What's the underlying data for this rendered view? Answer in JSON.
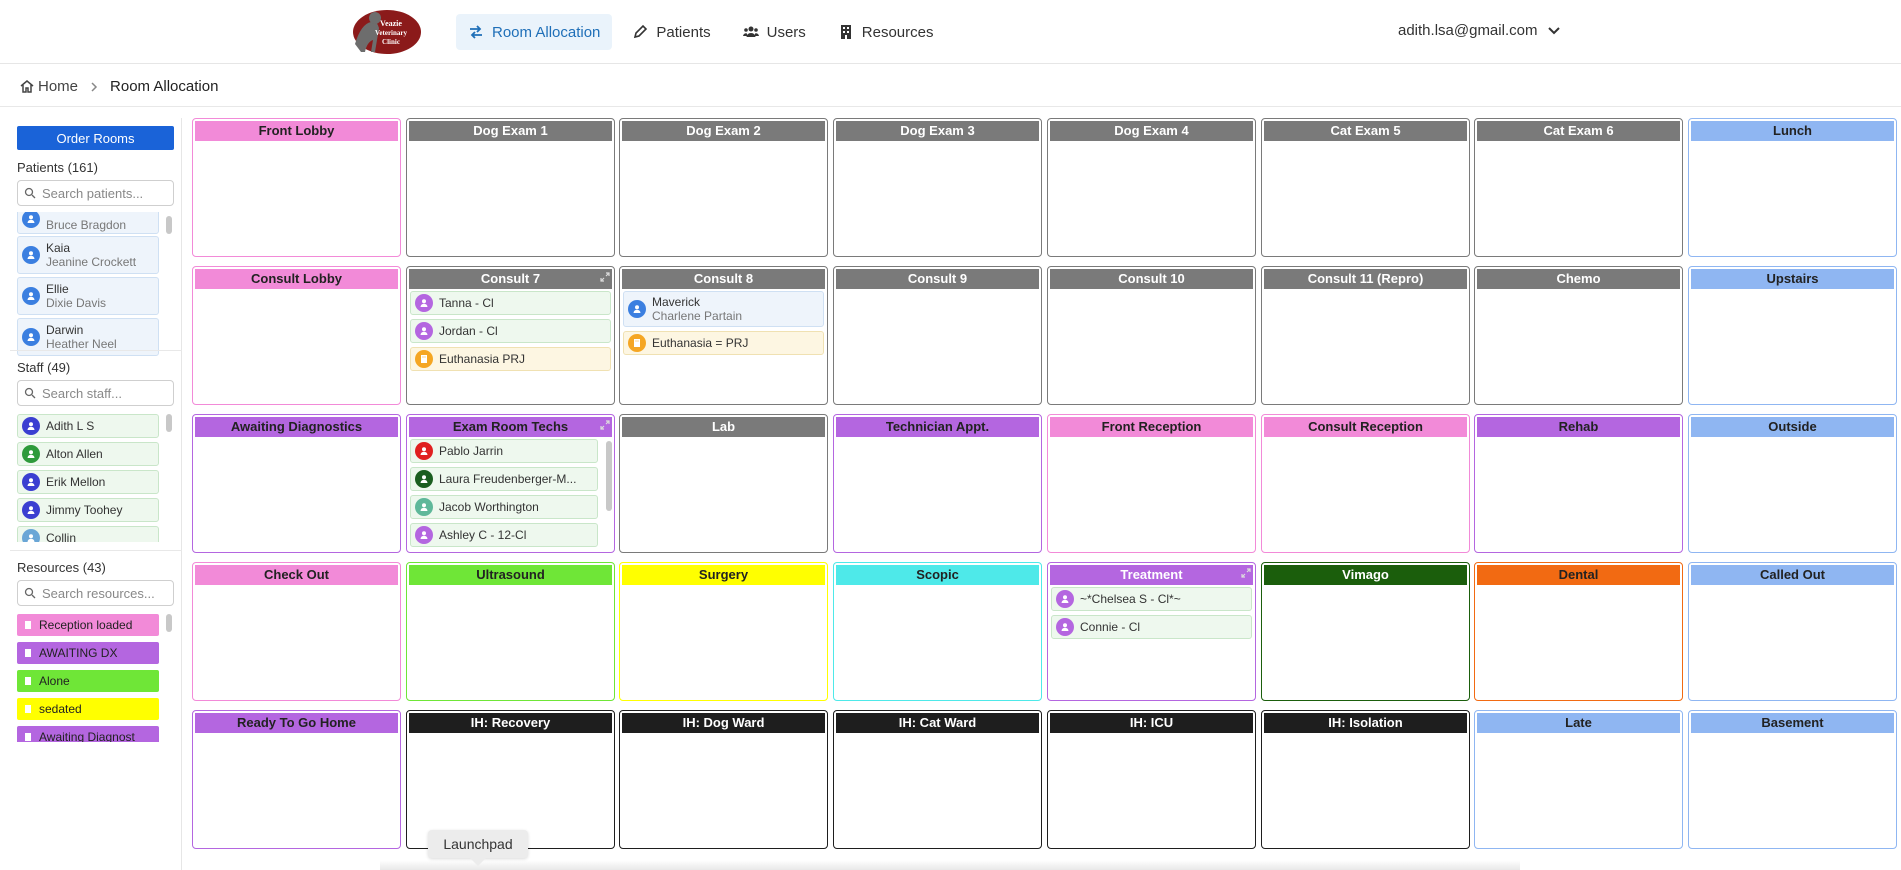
{
  "clinic_logo": "Veazie Veterinary Clinic",
  "nav": {
    "items": [
      {
        "label": "Room Allocation",
        "icon": "swap-icon",
        "active": true
      },
      {
        "label": "Patients",
        "icon": "pencil-icon",
        "active": false
      },
      {
        "label": "Users",
        "icon": "users-icon",
        "active": false
      },
      {
        "label": "Resources",
        "icon": "building-icon",
        "active": false
      }
    ],
    "user_email": "adith.lsa@gmail.com"
  },
  "breadcrumb": {
    "home": "Home",
    "current": "Room Allocation"
  },
  "sidebar": {
    "order_button": "Order Rooms",
    "patients": {
      "title": "Patients (161)",
      "placeholder": "Search patients...",
      "items": [
        {
          "name": "",
          "owner": "Bruce Bragdon"
        },
        {
          "name": "Kaia",
          "owner": "Jeanine Crockett"
        },
        {
          "name": "Ellie",
          "owner": "Dixie Davis"
        },
        {
          "name": "Darwin",
          "owner": "Heather Neel"
        }
      ]
    },
    "staff": {
      "title": "Staff (49)",
      "placeholder": "Search staff...",
      "items": [
        {
          "name": "Adith L S",
          "color": "#3b3fd1"
        },
        {
          "name": "Alton Allen",
          "color": "#2e9a3b"
        },
        {
          "name": "Erik Mellon",
          "color": "#3b3fd1"
        },
        {
          "name": "Jimmy Toohey",
          "color": "#3b3fd1"
        },
        {
          "name": "Collin",
          "color": "#6aa6d6"
        }
      ]
    },
    "resources": {
      "title": "Resources (43)",
      "placeholder": "Search resources...",
      "items": [
        {
          "label": "Reception loaded",
          "color": "#f28ad8"
        },
        {
          "label": "AWAITING DX",
          "color": "#b466e0"
        },
        {
          "label": "Alone",
          "color": "#6fe637"
        },
        {
          "label": "sedated",
          "color": "#ffff00"
        },
        {
          "label": "Awaiting Diagnost",
          "color": "#b466e0"
        }
      ]
    }
  },
  "rooms": [
    {
      "name": "Front Lobby",
      "color": "#f28ad8",
      "dark": true,
      "cards": []
    },
    {
      "name": "Dog Exam 1",
      "color": "#7a7a7a",
      "dark": false,
      "cards": []
    },
    {
      "name": "Dog Exam 2",
      "color": "#7a7a7a",
      "dark": false,
      "cards": []
    },
    {
      "name": "Dog Exam 3",
      "color": "#7a7a7a",
      "dark": false,
      "cards": []
    },
    {
      "name": "Dog Exam 4",
      "color": "#7a7a7a",
      "dark": false,
      "cards": []
    },
    {
      "name": "Cat Exam 5",
      "color": "#7a7a7a",
      "dark": false,
      "cards": []
    },
    {
      "name": "Cat Exam 6",
      "color": "#7a7a7a",
      "dark": false,
      "cards": []
    },
    {
      "name": "Lunch",
      "color": "#8fb6f2",
      "dark": true,
      "cards": []
    },
    {
      "name": "Consult Lobby",
      "color": "#f28ad8",
      "dark": true,
      "cards": []
    },
    {
      "name": "Consult 7",
      "color": "#7a7a7a",
      "dark": false,
      "expand": true,
      "cards": [
        {
          "type": "staff",
          "label": "Tanna - Cl",
          "color": "#b466e0"
        },
        {
          "type": "staff",
          "label": "Jordan - Cl",
          "color": "#b466e0"
        },
        {
          "type": "res",
          "label": "Euthanasia PRJ",
          "color": "#f5a623"
        }
      ]
    },
    {
      "name": "Consult 8",
      "color": "#7a7a7a",
      "dark": false,
      "cards": [
        {
          "type": "patient",
          "label": "Maverick",
          "sub": "Charlene Partain",
          "color": "#3b7fe0"
        },
        {
          "type": "res",
          "label": "Euthanasia = PRJ",
          "color": "#f5a623"
        }
      ]
    },
    {
      "name": "Consult 9",
      "color": "#7a7a7a",
      "dark": false,
      "cards": []
    },
    {
      "name": "Consult 10",
      "color": "#7a7a7a",
      "dark": false,
      "cards": []
    },
    {
      "name": "Consult 11 (Repro)",
      "color": "#7a7a7a",
      "dark": false,
      "cards": []
    },
    {
      "name": "Chemo",
      "color": "#7a7a7a",
      "dark": false,
      "cards": []
    },
    {
      "name": "Upstairs",
      "color": "#8fb6f2",
      "dark": true,
      "cards": []
    },
    {
      "name": "Awaiting Diagnostics",
      "color": "#b466e0",
      "dark": true,
      "cards": []
    },
    {
      "name": "Exam Room Techs",
      "color": "#b466e0",
      "dark": true,
      "expand": true,
      "cards": [
        {
          "type": "staff",
          "label": "Pablo Jarrin",
          "color": "#e02020"
        },
        {
          "type": "staff",
          "label": "Laura Freudenberger-M...",
          "color": "#1b5e20"
        },
        {
          "type": "staff",
          "label": "Jacob Worthington",
          "color": "#5fb89a"
        },
        {
          "type": "staff",
          "label": "Ashley C - 12-Cl",
          "color": "#b466e0"
        }
      ]
    },
    {
      "name": "Lab",
      "color": "#7a7a7a",
      "dark": false,
      "cards": []
    },
    {
      "name": "Technician Appt.",
      "color": "#b466e0",
      "dark": true,
      "cards": []
    },
    {
      "name": "Front Reception",
      "color": "#f28ad8",
      "dark": true,
      "cards": []
    },
    {
      "name": "Consult Reception",
      "color": "#f28ad8",
      "dark": true,
      "cards": []
    },
    {
      "name": "Rehab",
      "color": "#b466e0",
      "dark": true,
      "cards": []
    },
    {
      "name": "Outside",
      "color": "#8fb6f2",
      "dark": true,
      "cards": []
    },
    {
      "name": "Check Out",
      "color": "#f28ad8",
      "dark": true,
      "cards": []
    },
    {
      "name": "Ultrasound",
      "color": "#6fe637",
      "dark": true,
      "cards": []
    },
    {
      "name": "Surgery",
      "color": "#ffff00",
      "dark": true,
      "cards": []
    },
    {
      "name": "Scopic",
      "color": "#4ee9e9",
      "dark": true,
      "cards": []
    },
    {
      "name": "Treatment",
      "color": "#b466e0",
      "dark": false,
      "expand": true,
      "cards": [
        {
          "type": "staff",
          "label": "~*Chelsea S - Cl*~",
          "color": "#b466e0"
        },
        {
          "type": "staff",
          "label": "Connie - Cl",
          "color": "#b466e0"
        }
      ]
    },
    {
      "name": "Vimago",
      "color": "#1b5e0c",
      "dark": false,
      "cards": []
    },
    {
      "name": "Dental",
      "color": "#f26a12",
      "dark": true,
      "cards": []
    },
    {
      "name": "Called Out",
      "color": "#8fb6f2",
      "dark": true,
      "cards": []
    },
    {
      "name": "Ready To Go Home",
      "color": "#b466e0",
      "dark": true,
      "cards": []
    },
    {
      "name": "IH: Recovery",
      "color": "#1e1e1e",
      "dark": false,
      "cards": []
    },
    {
      "name": "IH: Dog Ward",
      "color": "#1e1e1e",
      "dark": false,
      "cards": []
    },
    {
      "name": "IH: Cat Ward",
      "color": "#1e1e1e",
      "dark": false,
      "cards": []
    },
    {
      "name": "IH: ICU",
      "color": "#1e1e1e",
      "dark": false,
      "cards": []
    },
    {
      "name": "IH: Isolation",
      "color": "#1e1e1e",
      "dark": false,
      "cards": []
    },
    {
      "name": "Late",
      "color": "#8fb6f2",
      "dark": true,
      "cards": []
    },
    {
      "name": "Basement",
      "color": "#8fb6f2",
      "dark": true,
      "cards": []
    }
  ],
  "launchpad": "Launchpad"
}
